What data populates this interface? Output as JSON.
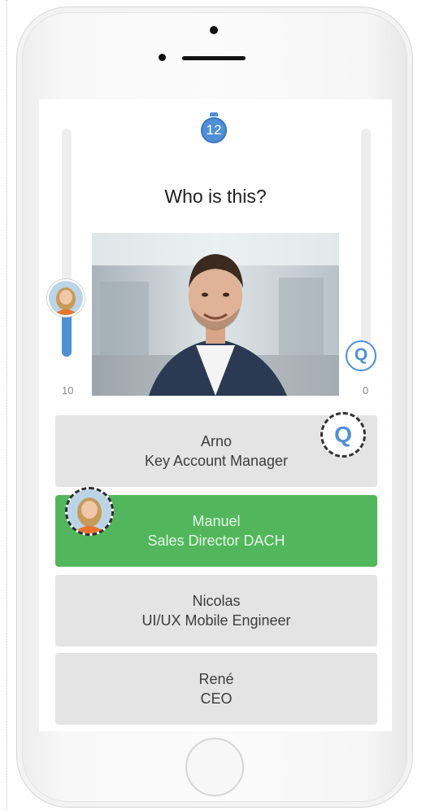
{
  "quiz": {
    "timer": "12",
    "question": "Who is this?",
    "score_left": "10",
    "score_right": "0",
    "score_left_fraction": 0.33,
    "robot_symbol": "Q",
    "answers": [
      {
        "name": "Arno",
        "role": "Key Account Manager",
        "state": "default"
      },
      {
        "name": "Manuel",
        "role": "Sales Director DACH",
        "state": "correct"
      },
      {
        "name": "Nicolas",
        "role": "UI/UX Mobile Engineer",
        "state": "default"
      },
      {
        "name": "René",
        "role": "CEO",
        "state": "default"
      }
    ]
  },
  "colors": {
    "accent": "#4f8fd6",
    "correct": "#52b75c",
    "answer_bg": "#e4e4e4"
  },
  "icons": {
    "timer": "stopwatch-icon",
    "robot": "robot-opponent-icon",
    "player": "player-avatar"
  }
}
